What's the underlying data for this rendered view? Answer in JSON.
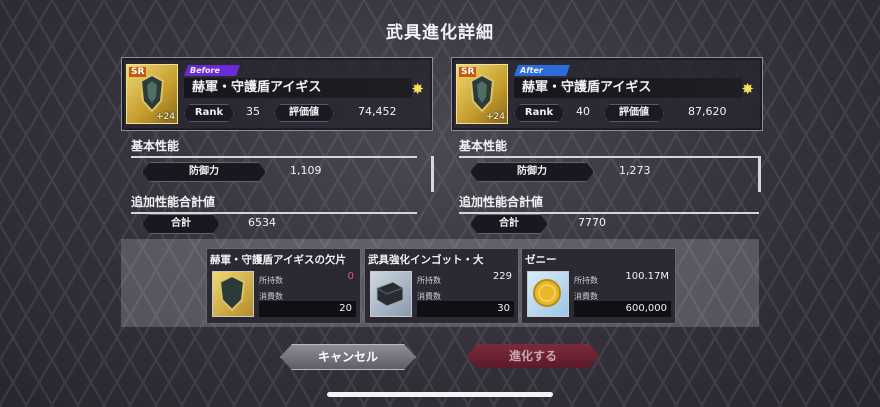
{
  "title": "武具進化詳細",
  "before": {
    "tag": "Before",
    "rarity": "SR",
    "plus": "+24",
    "name": "赫軍・守護盾アイギス",
    "rank_label": "Rank",
    "rank": "35",
    "eval_label": "評価値",
    "eval": "74,452"
  },
  "after": {
    "tag": "After",
    "rarity": "SR",
    "plus": "+24",
    "name": "赫軍・守護盾アイギス",
    "rank_label": "Rank",
    "rank": "40",
    "eval_label": "評価値",
    "eval": "87,620"
  },
  "basic": {
    "heading": "基本性能",
    "defense_label": "防御力",
    "before": "1,109",
    "after": "1,273"
  },
  "additional": {
    "heading": "追加性能合計値",
    "total_label": "合計",
    "before": "6534",
    "after": "7770"
  },
  "materials": {
    "owned_label": "所持数",
    "cost_label": "消費数",
    "items": [
      {
        "name": "赫軍・守護盾アイギスの欠片",
        "owned": "0",
        "cost": "20",
        "owned_color": "#e05a6a"
      },
      {
        "name": "武具強化インゴット・大",
        "owned": "229",
        "cost": "30",
        "owned_color": "#ffffff"
      },
      {
        "name": "ゼニー",
        "owned": "100.17M",
        "cost": "600,000",
        "owned_color": "#ffffff"
      }
    ]
  },
  "buttons": {
    "cancel": "キャンセル",
    "evolve": "進化する"
  }
}
